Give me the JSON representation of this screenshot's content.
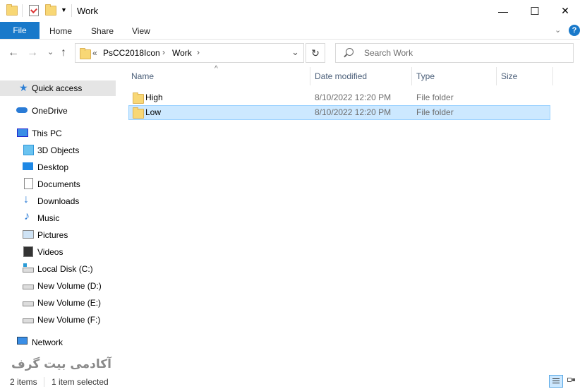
{
  "window": {
    "title": "Work",
    "minimize": "—",
    "maximize": "☐",
    "close": "✕"
  },
  "ribbon": {
    "file": "File",
    "tabs": [
      "Home",
      "Share",
      "View"
    ],
    "help": "?",
    "collapse": "⌄"
  },
  "nav": {
    "back": "←",
    "forward": "→",
    "recent": "⌄",
    "up": "↑",
    "breadcrumb_overflow": "«",
    "path": [
      "PsCC2018Icon",
      "Work"
    ],
    "separator": "›",
    "dropdown": "⌄",
    "refresh": "↻",
    "search_placeholder": "Search Work"
  },
  "sidebar": {
    "items": [
      {
        "label": "Quick access",
        "icon": "star-icon"
      },
      {
        "label": "OneDrive",
        "icon": "cloud-icon"
      },
      {
        "label": "This PC",
        "icon": "computer-icon"
      },
      {
        "label": "3D Objects",
        "icon": "cube-icon"
      },
      {
        "label": "Desktop",
        "icon": "desktop-icon"
      },
      {
        "label": "Documents",
        "icon": "document-icon"
      },
      {
        "label": "Downloads",
        "icon": "download-icon"
      },
      {
        "label": "Music",
        "icon": "music-icon"
      },
      {
        "label": "Pictures",
        "icon": "picture-icon"
      },
      {
        "label": "Videos",
        "icon": "video-icon"
      },
      {
        "label": "Local Disk (C:)",
        "icon": "windows-drive-icon"
      },
      {
        "label": "New Volume (D:)",
        "icon": "drive-icon"
      },
      {
        "label": "New Volume (E:)",
        "icon": "drive-icon"
      },
      {
        "label": "New Volume (F:)",
        "icon": "drive-icon"
      },
      {
        "label": "Network",
        "icon": "network-icon"
      }
    ]
  },
  "columns": {
    "sort_indicator": "^",
    "name": "Name",
    "date": "Date modified",
    "type": "Type",
    "size": "Size"
  },
  "files": [
    {
      "name": "High",
      "date": "8/10/2022 12:20 PM",
      "type": "File folder",
      "size": ""
    },
    {
      "name": "Low",
      "date": "8/10/2022 12:20 PM",
      "type": "File folder",
      "size": ""
    }
  ],
  "status": {
    "count": "2 items",
    "selected": "1 item selected"
  },
  "watermark": "آکادمی بیت گرف",
  "colors": {
    "accent": "#1979ca",
    "selection": "#cce8ff",
    "folder": "#f8d775"
  }
}
